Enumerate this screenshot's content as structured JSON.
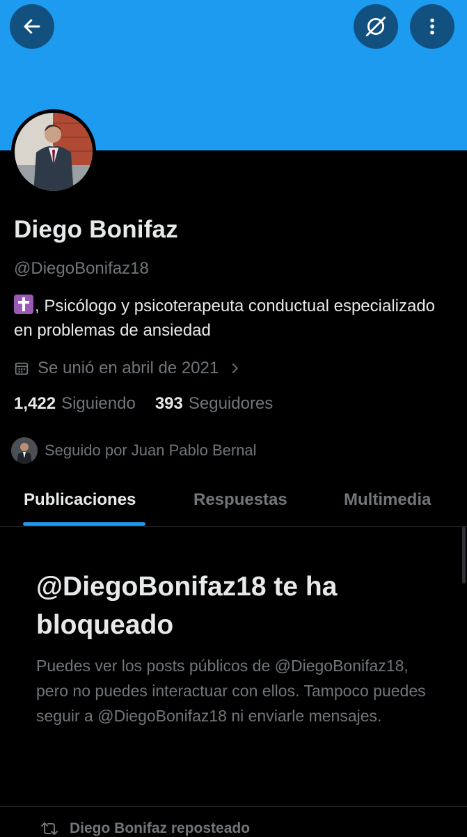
{
  "colors": {
    "banner": "#1d9bf0",
    "accent": "#1d9bf0",
    "background": "#000000",
    "primary_text": "#e7e9ea",
    "secondary_text": "#71767b"
  },
  "header": {
    "back_icon": "arrow-left-icon",
    "grok_icon": "grok-icon",
    "more_icon": "more-vertical-icon"
  },
  "profile": {
    "display_name": "Diego Bonifaz",
    "handle": "@DiegoBonifaz18",
    "bio_emoji": "latin-cross-emoji",
    "bio_text": ", Psicólogo y psicoterapeuta conductual especializado en problemas de ansiedad",
    "joined": "Se unió en abril de 2021",
    "following_count": "1,422",
    "following_label": "Siguiendo",
    "followers_count": "393",
    "followers_label": "Seguidores",
    "followed_by": "Seguido por Juan Pablo Bernal"
  },
  "tabs": [
    {
      "label": "Publicaciones",
      "active": true
    },
    {
      "label": "Respuestas",
      "active": false
    },
    {
      "label": "Multimedia",
      "active": false
    }
  ],
  "blocked": {
    "title": "@DiegoBonifaz18 te ha bloqueado",
    "description": "Puedes ver los posts públicos de @DiegoBonifaz18, pero no puedes interactuar con ellos. Tampoco puedes seguir a @DiegoBonifaz18 ni enviarle mensajes."
  },
  "feed": {
    "repost_label": "Diego Bonifaz reposteado"
  }
}
